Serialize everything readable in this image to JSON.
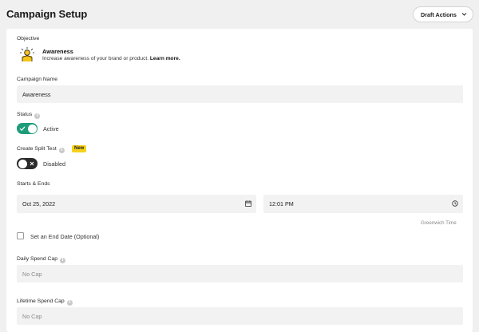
{
  "header": {
    "title": "Campaign Setup",
    "draft_actions_label": "Draft Actions"
  },
  "objective": {
    "label": "Objective",
    "title": "Awareness",
    "description": "Increase awareness of your brand or product.",
    "link": "Learn more."
  },
  "campaign_name": {
    "label": "Campaign Name",
    "value": "Awareness"
  },
  "status": {
    "label": "Status",
    "state_text": "Active",
    "enabled": true
  },
  "split_test": {
    "label": "Create Split Test",
    "badge": "New",
    "state_text": "Disabled",
    "enabled": false
  },
  "schedule": {
    "label": "Starts & Ends",
    "start_date": "Oct 25, 2022",
    "start_time": "12:01 PM",
    "timezone": "Greenwich Time",
    "end_date_option": "Set an End Date (Optional)"
  },
  "daily_spend_cap": {
    "label": "Daily Spend Cap",
    "placeholder": "No Cap"
  },
  "lifetime_spend_cap": {
    "label": "Lifetime Spend Cap",
    "placeholder": "No Cap"
  },
  "colors": {
    "accent_toggle_on": "#1d9c7a",
    "toggle_off": "#2b2b2b",
    "new_badge": "#f6d21a",
    "objective_icon": "#f4c419"
  },
  "icons": {
    "draft_actions": "chevron-down-icon",
    "objective": "megaphone-person-icon",
    "info": "info-icon",
    "date": "calendar-icon",
    "time": "clock-icon",
    "toggle_on": "check-icon",
    "toggle_off": "x-icon"
  }
}
